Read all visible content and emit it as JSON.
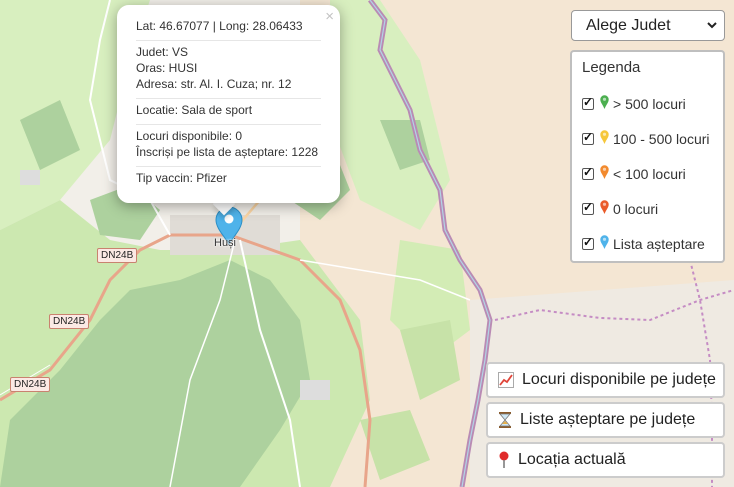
{
  "popup": {
    "close": "×",
    "coords": "Lat: 46.67077 | Long: 28.06433",
    "judet": "Judet: VS",
    "oras": "Oras: HUSI",
    "adresa": "Adresa: str. Al. I. Cuza; nr. 12",
    "locatie": "Locatie: Sala de sport",
    "locuri": "Locuri disponibile: 0",
    "inscrisi": "Înscriși pe lista de așteptare: 1228",
    "vaccin": "Tip vaccin: Pfizer"
  },
  "county_select": {
    "selected": "Alege Judet"
  },
  "legend": {
    "title": "Legenda",
    "items": [
      {
        "label": "> 500 locuri",
        "color": "#4caf50",
        "checked": true
      },
      {
        "label": "100 - 500 locuri",
        "color": "#f6c73b",
        "checked": true
      },
      {
        "label": "< 100 locuri",
        "color": "#f28a2e",
        "checked": true
      },
      {
        "label": "0 locuri",
        "color": "#ea5b2a",
        "checked": true
      },
      {
        "label": "Lista așteptare",
        "color": "#4fb3ea",
        "checked": true
      }
    ]
  },
  "buttons": {
    "locuri": "Locuri disponibile pe județe",
    "liste": "Liste așteptare pe județe",
    "locatia": "Locația actuală"
  },
  "map": {
    "town": "Huși",
    "road_labels": [
      "DN24B",
      "DN24B",
      "DN24B"
    ],
    "marker_color": "#4fb3ea"
  }
}
